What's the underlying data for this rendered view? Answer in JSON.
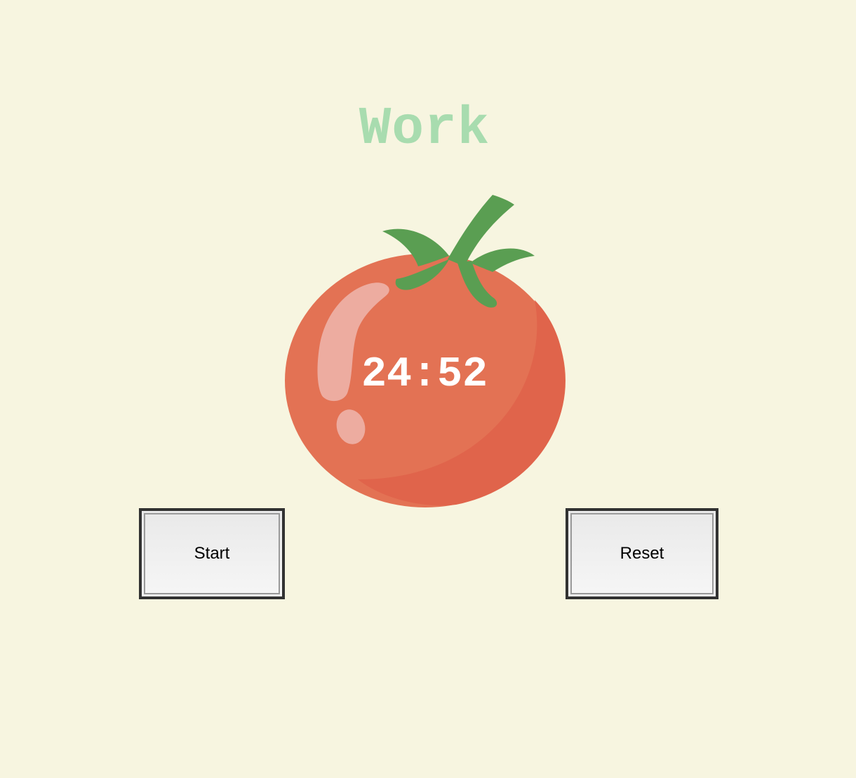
{
  "title": {
    "text": "Work",
    "color": "#a8dcaf"
  },
  "timer": {
    "text": "24:52",
    "color": "#ffffff"
  },
  "tomato": {
    "icon": "tomato-icon",
    "body_color": "#e37254",
    "shade_color": "#e0644b",
    "highlight_color": "#edaca0",
    "leaf_color": "#5a9e52"
  },
  "controls": {
    "start_label": "Start",
    "reset_label": "Reset"
  },
  "colors": {
    "background": "#f7f5e0",
    "button_border": "#323232"
  }
}
